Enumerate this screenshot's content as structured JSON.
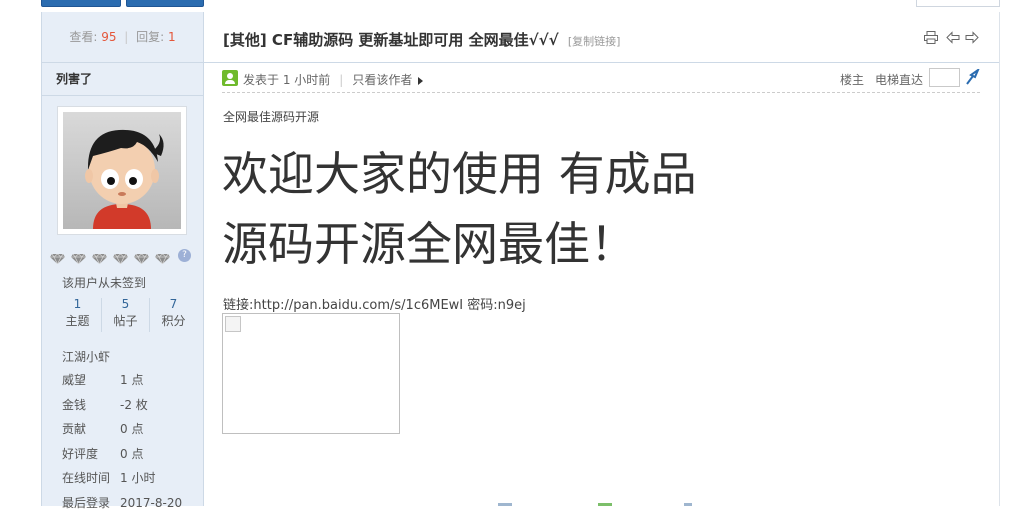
{
  "colors": {
    "accent": "#2b6cb0",
    "stat_number": "#e4563a",
    "sidebar_bg": "#e7eef7",
    "online_green": "#6fba2c"
  },
  "stats": {
    "views_label": "查看:",
    "views": "95",
    "separator": "|",
    "replies_label": "回复:",
    "replies": "1"
  },
  "author": {
    "name": "列害了",
    "signin_status": "该用户从未签到",
    "counts": [
      {
        "value": "1",
        "label": "主题"
      },
      {
        "value": "5",
        "label": "帖子"
      },
      {
        "value": "7",
        "label": "积分"
      }
    ],
    "rank": "江湖小虾",
    "info": [
      {
        "key": "威望",
        "value": "1 点"
      },
      {
        "key": "金钱",
        "value": "-2 枚"
      },
      {
        "key": "贡献",
        "value": "0 点"
      },
      {
        "key": "好评度",
        "value": "0 点"
      },
      {
        "key": "在线时间",
        "value": "1 小时"
      },
      {
        "key": "最后登录",
        "value": "2017-8-20"
      }
    ],
    "medal_count": 6,
    "help_icon": "?"
  },
  "thread": {
    "title": "[其他] CF辅助源码 更新基址即可用 全网最佳√√√",
    "copy_link": "[复制链接]",
    "icons": [
      "print-icon",
      "prev-thread-icon",
      "next-thread-icon"
    ]
  },
  "post": {
    "posted": "发表于 1 小时前",
    "only_author": "只看该作者",
    "floor": "楼主",
    "elevator": "电梯直达",
    "subtitle": "全网最佳源码开源",
    "big_line1": "欢迎大家的使用 有成品",
    "big_line2": "源码开源全网最佳！",
    "link_text": "链接:http://pan.baidu.com/s/1c6MEwI 密码:n9ej"
  }
}
